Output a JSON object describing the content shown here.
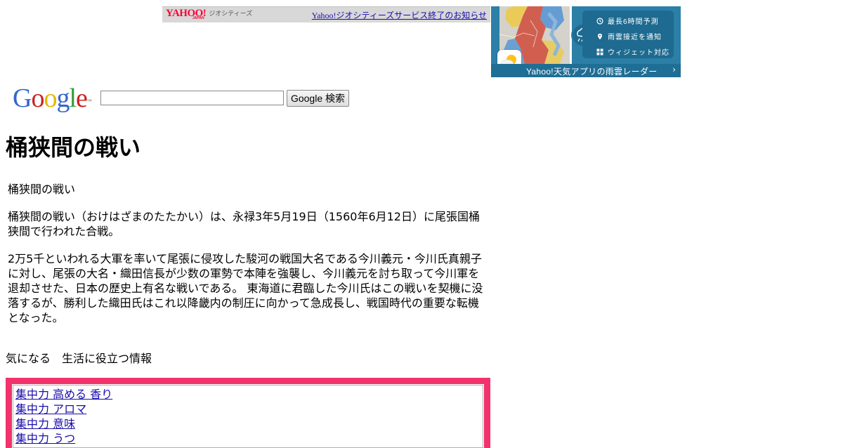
{
  "geo_banner": {
    "logo_text": "YAHOO!",
    "logo_japan": "JAPAN",
    "logo_sub": "ジオシティーズ",
    "notice_link": "Yahoo!ジオシティーズサービス終了のお知らせ"
  },
  "ad": {
    "features": [
      "最長6時間予測",
      "雨雲接近を通知",
      "ウィジェット対応"
    ],
    "bar_text": "Yahoo!天気アプリの雨雲レーダー",
    "chevron": "›",
    "colors": {
      "background": "#2c7fa6",
      "panel": "#1e6a90"
    }
  },
  "google": {
    "logo_letters": [
      "G",
      "o",
      "o",
      "g",
      "l",
      "e"
    ],
    "trademark": "™",
    "search_value": "",
    "button_label": "Google 検索"
  },
  "article": {
    "title": "桶狭間の戦い",
    "subtitle": "桶狭間の戦い",
    "paragraphs": [
      "桶狭間の戦い（おけはざまのたたかい）は、永禄3年5月19日（1560年6月12日）に尾張国桶狭間で行われた合戦。",
      "2万5千といわれる大軍を率いて尾張に侵攻した駿河の戦国大名である今川義元・今川氏真親子に対し、尾張の大名・織田信長が少数の軍勢で本陣を強襲し、今川義元を討ち取って今川軍を退却させた、日本の歴史上有名な戦いである。 東海道に君臨した今川氏はこの戦いを契機に没落するが、勝利した織田氏はこれ以降畿内の制圧に向かって急成長し、戦国時代の重要な転機となった。"
    ]
  },
  "info_section": {
    "label": "気になる　生活に役立つ情報",
    "links": [
      "集中力 高める 香り",
      "集中力 アロマ",
      "集中力 意味",
      "集中力 うつ"
    ],
    "box_color": "#f2336b"
  }
}
